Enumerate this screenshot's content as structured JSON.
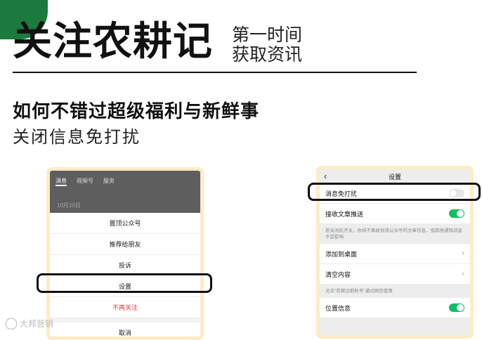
{
  "header": {
    "title": "关注农耕记",
    "subtitle_line1": "第一时间",
    "subtitle_line2": "获取资讯"
  },
  "headline": {
    "line1": "如何不错过超级福利与新鲜事",
    "line2": "关闭信息免打扰"
  },
  "left_phone": {
    "tabs": [
      "消息",
      "视频号",
      "服务"
    ],
    "date": "10月10日",
    "menu": [
      "置顶公众号",
      "推荐给朋友",
      "投诉",
      "设置",
      "不再关注",
      "取消"
    ]
  },
  "right_phone": {
    "title": "设置",
    "rows": {
      "dnd": "消息免打扰",
      "receive": "接收文章推送",
      "note1": "若关闭此开关，你将不再收到该公众号的文章信息，但其他通知消息不受影响",
      "add_desktop": "添加到桌面",
      "clear": "清空内容",
      "note2": "允许\"农耕记稻秋号\"通过网页使用",
      "location": "位置信息"
    },
    "toggles": {
      "dnd": false,
      "receive": true,
      "location": true
    }
  },
  "watermark": "大邦营销",
  "colors": {
    "accent_green": "#1d7a3e",
    "toggle_on": "#07c160",
    "frame": "#fdecc6"
  }
}
